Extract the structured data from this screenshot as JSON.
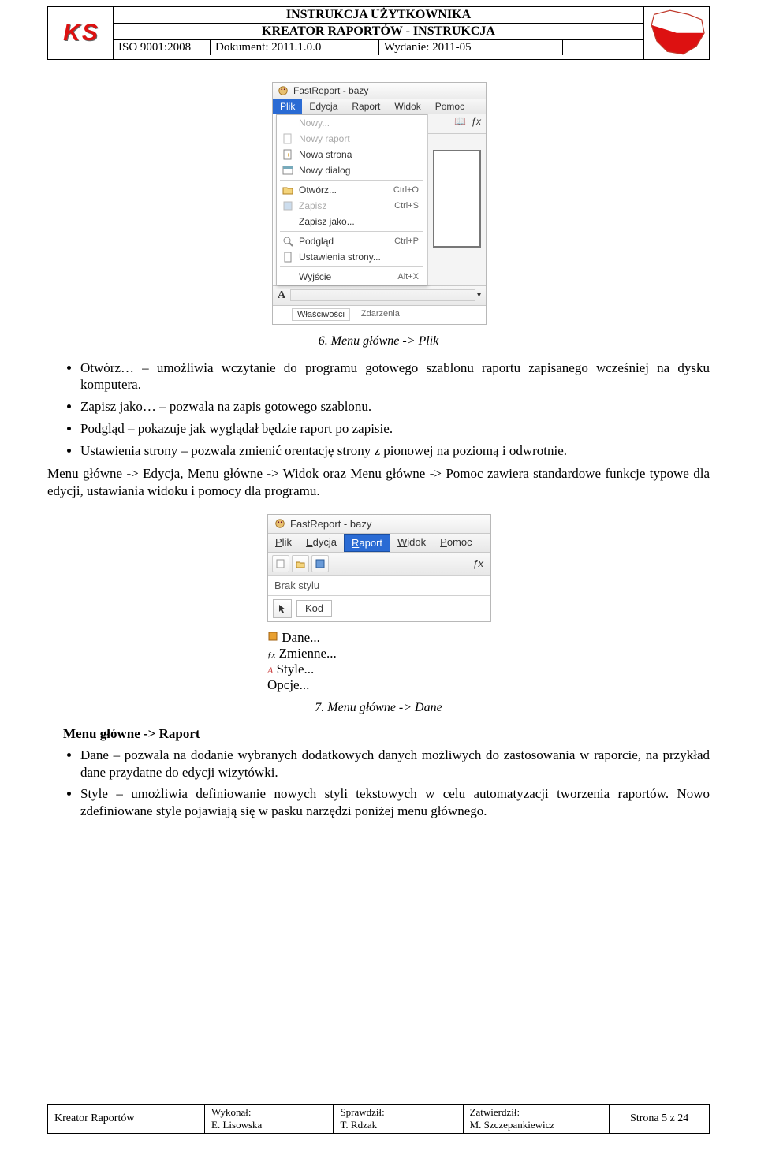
{
  "header": {
    "title1": "INSTRUKCJA UŻYTKOWNIKA",
    "title2": "KREATOR RAPORTÓW - INSTRUKCJA",
    "iso": "ISO 9001:2008",
    "doc": "Dokument: 2011.1.0.0",
    "wydanie": "Wydanie: 2011-05"
  },
  "shot1": {
    "title": "FastReport - bazy",
    "menu": {
      "plik": "Plik",
      "edycja": "Edycja",
      "raport": "Raport",
      "widok": "Widok",
      "pomoc": "Pomoc"
    },
    "items": {
      "nowy": "Nowy...",
      "nowy_raport": "Nowy raport",
      "nowa_strona": "Nowa strona",
      "nowy_dialog": "Nowy dialog",
      "otworz": "Otwórz...",
      "otworz_sc": "Ctrl+O",
      "zapisz": "Zapisz",
      "zapisz_sc": "Ctrl+S",
      "zapisz_jako": "Zapisz jako...",
      "podglad": "Podgląd",
      "podglad_sc": "Ctrl+P",
      "ustawienia": "Ustawienia strony...",
      "wyjscie": "Wyjście",
      "wyjscie_sc": "Alt+X"
    },
    "tabs": {
      "wl": "Właściwości",
      "zd": "Zdarzenia"
    }
  },
  "caption1": "6.   Menu główne -> Plik",
  "bullets1": {
    "b1": "Otwórz… – umożliwia wczytanie do programu gotowego szablonu raportu zapisanego wcześniej na dysku komputera.",
    "b2": "Zapisz jako… – pozwala na zapis gotowego szablonu.",
    "b3": "Podgląd – pokazuje jak wyglądał będzie raport po zapisie.",
    "b4": "Ustawienia strony – pozwala zmienić orentację strony z pionowej na poziomą i odwrotnie."
  },
  "para1": "Menu główne -> Edycja, Menu główne -> Widok oraz Menu główne -> Pomoc zawiera standardowe funkcje typowe dla edycji, ustawiania widoku i pomocy dla programu.",
  "shot2": {
    "title": "FastReport - bazy",
    "menu": {
      "plik": "Plik",
      "edycja": "Edycja",
      "raport": "Raport",
      "widok": "Widok",
      "pomoc": "Pomoc"
    },
    "dd": {
      "dane": "Dane...",
      "zmienne": "Zmienne...",
      "style": "Style...",
      "opcje": "Opcje..."
    },
    "brak": "Brak stylu",
    "kod": "Kod",
    "fx": "ƒx"
  },
  "caption2": "7.   Menu główne -> Dane",
  "section_head": "Menu główne -> Raport",
  "bullets2": {
    "b1": "Dane – pozwala na dodanie wybranych dodatkowych danych możliwych do zastosowania w raporcie, na przykład dane przydatne do edycji wizytówki.",
    "b2": "Style – umożliwia definiowanie nowych styli tekstowych w celu automatyzacji tworzenia raportów. Nowo zdefiniowane style pojawiają się w pasku narzędzi poniżej menu głównego."
  },
  "footer": {
    "kr": "Kreator Raportów",
    "wyk_l": "Wykonał:",
    "wyk_v": "E. Lisowska",
    "spr_l": "Sprawdził:",
    "spr_v": "T. Rdzak",
    "zat_l": "Zatwierdził:",
    "zat_v": "M. Szczepankiewicz",
    "page": "Strona 5 z 24"
  }
}
